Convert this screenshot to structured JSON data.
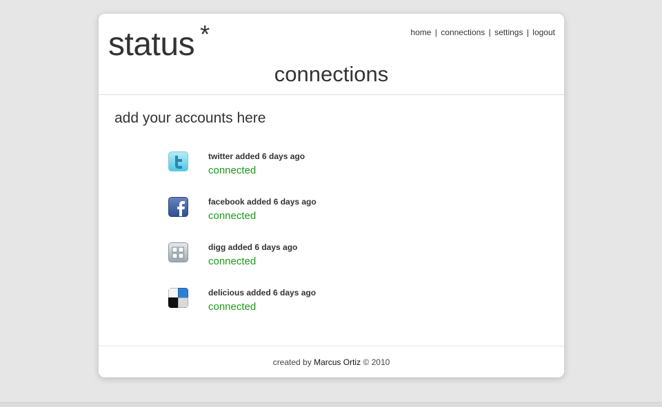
{
  "header": {
    "logo_text": "status",
    "logo_mark": "*",
    "page_title": "connections",
    "nav": [
      {
        "label": "home"
      },
      {
        "label": "connections"
      },
      {
        "label": "settings"
      },
      {
        "label": "logout"
      }
    ],
    "nav_separator": "|"
  },
  "main": {
    "heading": "add your accounts here",
    "accounts": [
      {
        "service": "twitter",
        "title": "twitter added 6 days ago",
        "status": "connected",
        "icon": "twitter-icon"
      },
      {
        "service": "facebook",
        "title": "facebook added 6 days ago",
        "status": "connected",
        "icon": "facebook-icon"
      },
      {
        "service": "digg",
        "title": "digg added 6 days ago",
        "status": "connected",
        "icon": "digg-icon"
      },
      {
        "service": "delicious",
        "title": "delicious added 6 days ago",
        "status": "connected",
        "icon": "delicious-icon"
      }
    ]
  },
  "footer": {
    "prefix": "created by",
    "author": "Marcus Ortiz",
    "suffix": "© 2010"
  },
  "colors": {
    "background": "#e6e6e6",
    "card": "#ffffff",
    "text": "#333333",
    "connected": "#1a9a1a"
  }
}
